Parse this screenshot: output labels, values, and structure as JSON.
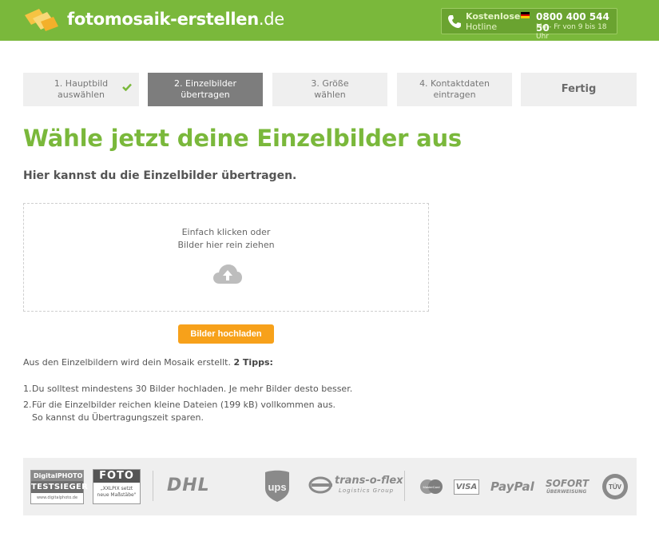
{
  "header": {
    "brand_main": "fotomosaik-erstellen",
    "brand_tld": ".de",
    "hotline_label1": "Kostenlose",
    "hotline_label2": "Hotline",
    "hotline_number": "0800 400 544 50",
    "hotline_hours": "Mo - Fr von 9 bis 18 Uhr",
    "brand_color": "#7ab83b",
    "accent_color": "#f7a11a"
  },
  "steps": [
    {
      "label_line1": "1. Hauptbild",
      "label_line2": "auswählen",
      "state": "done"
    },
    {
      "label_line1": "2. Einzelbilder",
      "label_line2": "übertragen",
      "state": "active"
    },
    {
      "label_line1": "3. Größe",
      "label_line2": "wählen",
      "state": "pending"
    },
    {
      "label_line1": "4. Kontaktdaten",
      "label_line2": "eintragen",
      "state": "pending"
    },
    {
      "label_line1": "Fertig",
      "label_line2": "",
      "state": "pending"
    }
  ],
  "main": {
    "title": "Wähle jetzt deine Einzelbilder aus",
    "subtitle": "Hier kannst du die Einzelbilder übertragen.",
    "dropzone_line1": "Einfach klicken oder",
    "dropzone_line2": "Bilder hier rein ziehen",
    "upload_button": "Bilder hochladen",
    "info_text": "Aus den Einzelbildern wird dein Mosaik erstellt.",
    "info_bold": "2 Tipps:",
    "tips": [
      {
        "num": "1.",
        "text": "Du solltest mindestens 30 Bilder hochladen. Je mehr Bilder desto besser."
      },
      {
        "num": "2.",
        "text": "Für die Einzelbilder reichen kleine Dateien (199 kB) vollkommen aus.",
        "text2": "So kannst du Übertragungszeit sparen."
      }
    ]
  },
  "footer": {
    "digitalphoto_top": "DigitalPHOTO",
    "digitalphoto_mid": "TESTSIEGER",
    "digitalphoto_url": "www.digitalphoto.de",
    "foto_top": "FOTO",
    "foto_quote1": "„XXLPIX setzt",
    "foto_quote2": "neue Maßstäbe\"",
    "dhl": "DHL",
    "ups": "ups",
    "transoflex": "trans-o-flex",
    "transoflex_sub": "Logistics Group",
    "mastercard": "MasterCard",
    "visa": "VISA",
    "paypal": "PayPal",
    "sofort": "SOFORT",
    "sofort_sub": "ÜBERWEISUNG",
    "tuv": "TÜV"
  }
}
